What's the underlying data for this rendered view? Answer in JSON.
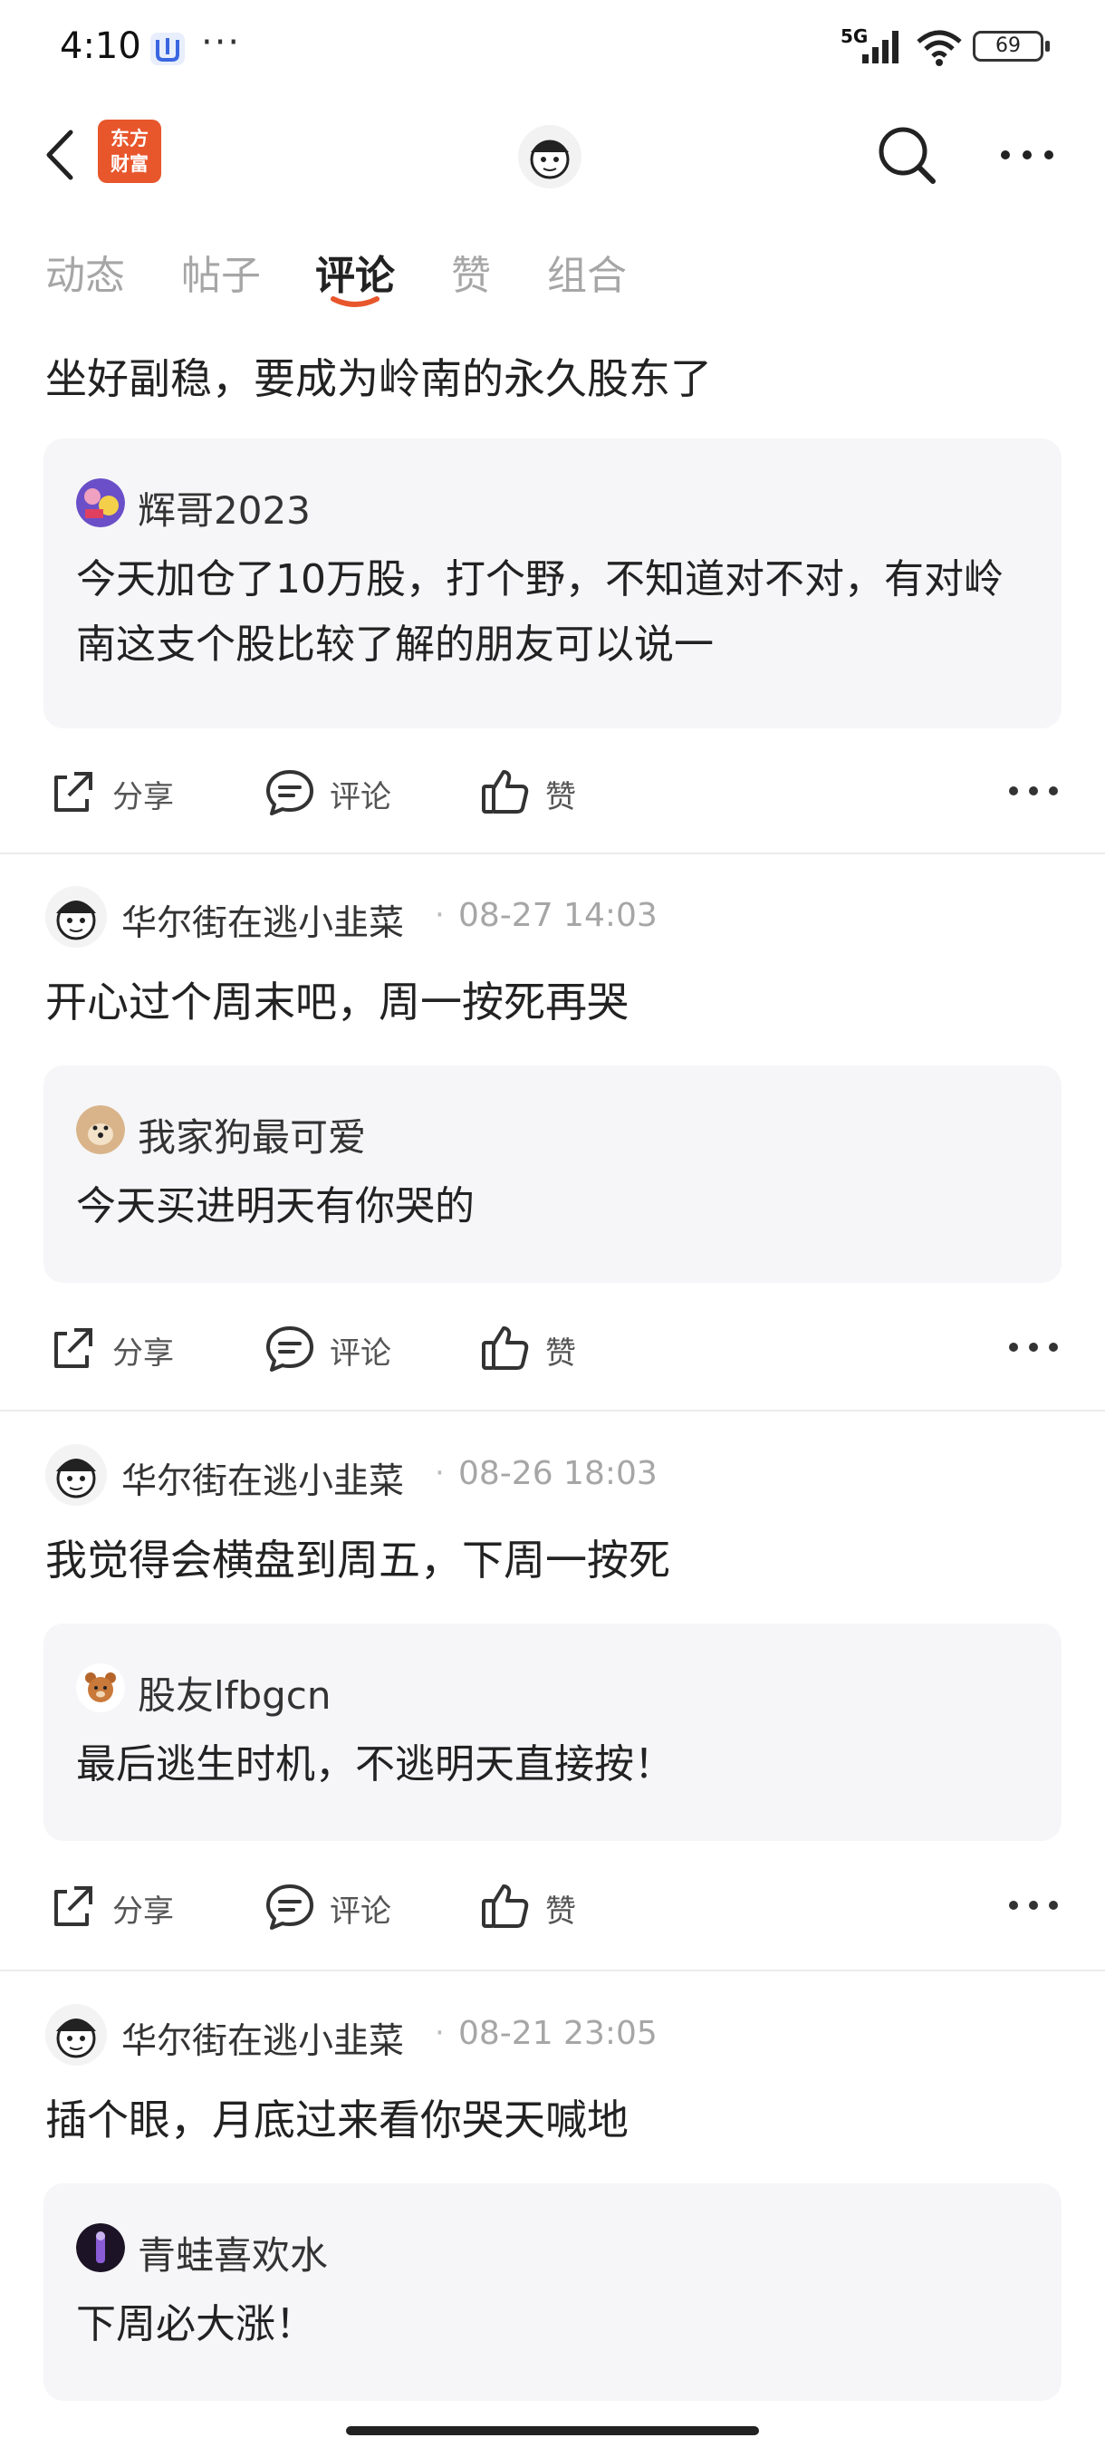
{
  "status_bar": {
    "time": "4:10",
    "dots": "···",
    "network": "5G",
    "battery": "69"
  },
  "nav": {
    "logo_line1": "东方",
    "logo_line2": "财富"
  },
  "tabs": [
    {
      "label": "动态"
    },
    {
      "label": "帖子"
    },
    {
      "label": "评论"
    },
    {
      "label": "赞"
    },
    {
      "label": "组合"
    }
  ],
  "actions": {
    "share": "分享",
    "comment": "评论",
    "like": "赞"
  },
  "first_post": {
    "text": "坐好副稳，要成为岭南的永久股东了",
    "quote": {
      "name": "辉哥2023",
      "text": "今天加仓了10万股，打个野，不知道对不对，有对岭南这支个股比较了解的朋友可以说一"
    }
  },
  "posts": [
    {
      "author": "华尔街在逃小韭菜",
      "time": "08-27 14:03",
      "text": "开心过个周末吧，周一按死再哭",
      "quote": {
        "name": "我家狗最可爱",
        "text": "今天买进明天有你哭的"
      }
    },
    {
      "author": "华尔街在逃小韭菜",
      "time": "08-26 18:03",
      "text": "我觉得会横盘到周五，下周一按死",
      "quote": {
        "name": "股友lfbgcn",
        "text": "最后逃生时机，不逃明天直接按！"
      }
    },
    {
      "author": "华尔街在逃小韭菜",
      "time": "08-21 23:05",
      "text": "插个眼，月底过来看你哭天喊地",
      "quote": {
        "name": "青蛙喜欢水",
        "text": "下周必大涨！"
      }
    }
  ],
  "colors": {
    "accent": "#e8562c",
    "quote_bg": "#f6f6f8",
    "muted_text": "#a6a6a6"
  }
}
